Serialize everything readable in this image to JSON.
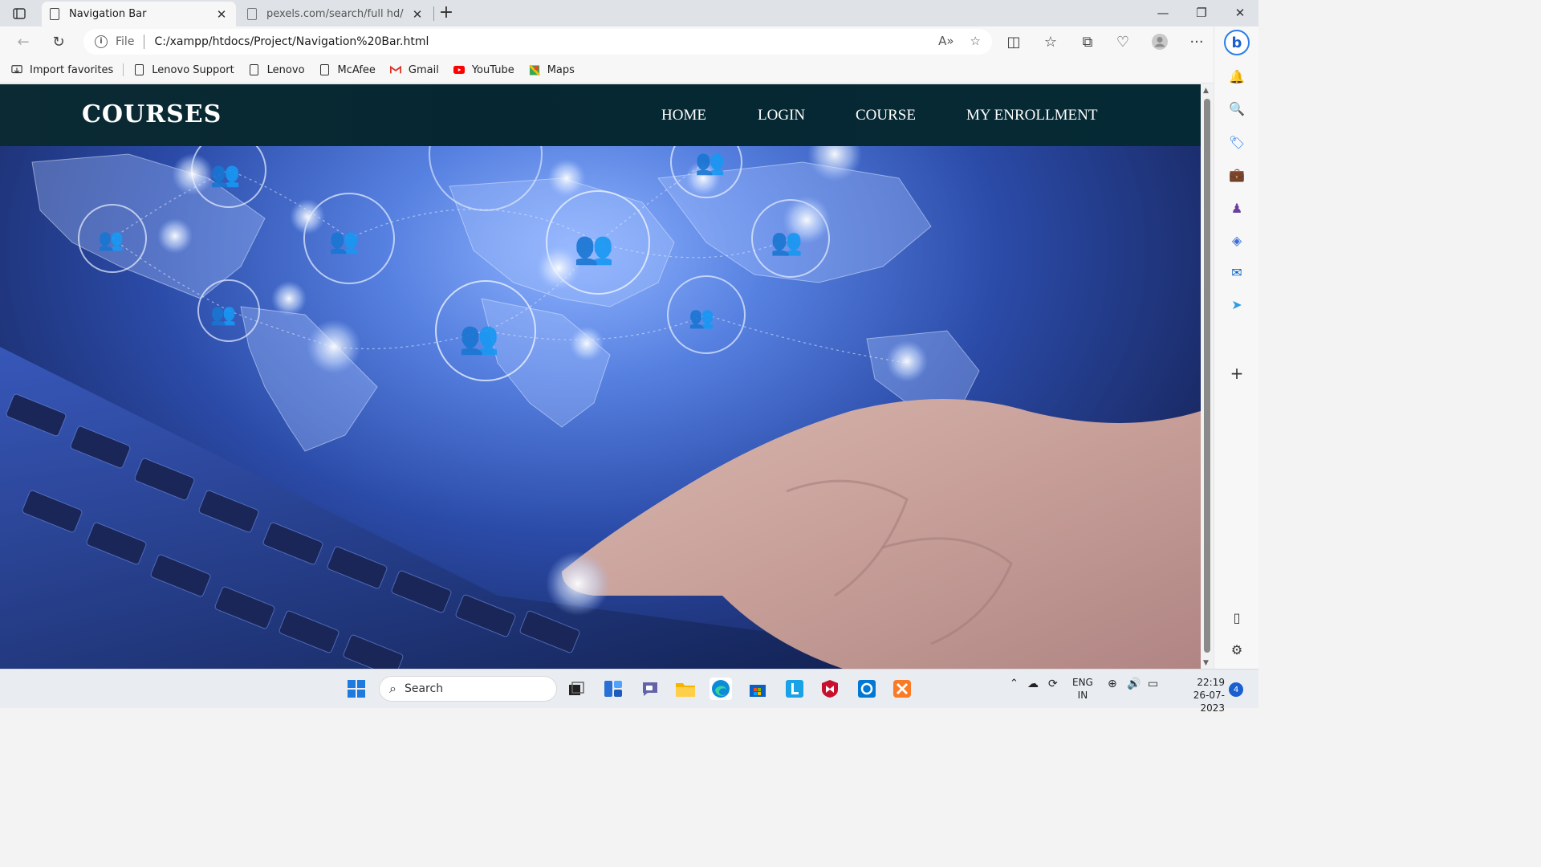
{
  "browser": {
    "tabs": [
      {
        "title": "Navigation Bar",
        "active": true
      },
      {
        "title": "pexels.com/search/full hd/",
        "active": false
      }
    ],
    "address": {
      "scheme_label": "File",
      "url": "C:/xampp/htdocs/Project/Navigation%20Bar.html"
    },
    "favorites": [
      {
        "label": "Import favorites",
        "icon": "import-icon"
      },
      {
        "label": "Lenovo Support",
        "icon": "page-icon"
      },
      {
        "label": "Lenovo",
        "icon": "page-icon"
      },
      {
        "label": "McAfee",
        "icon": "page-icon"
      },
      {
        "label": "Gmail",
        "icon": "gmail-icon"
      },
      {
        "label": "YouTube",
        "icon": "youtube-icon"
      },
      {
        "label": "Maps",
        "icon": "maps-icon"
      }
    ]
  },
  "site": {
    "brand": "COURSES",
    "nav": [
      "HOME",
      "LOGIN",
      "COURSE",
      "MY ENROLLMENT"
    ],
    "nav_bg": "#062732",
    "hero_accent": "#5680e0"
  },
  "taskbar": {
    "search_label": "Search",
    "lang_top": "ENG",
    "lang_bottom": "IN",
    "time": "22:19",
    "date": "26-07-2023",
    "notification_count": "4"
  }
}
